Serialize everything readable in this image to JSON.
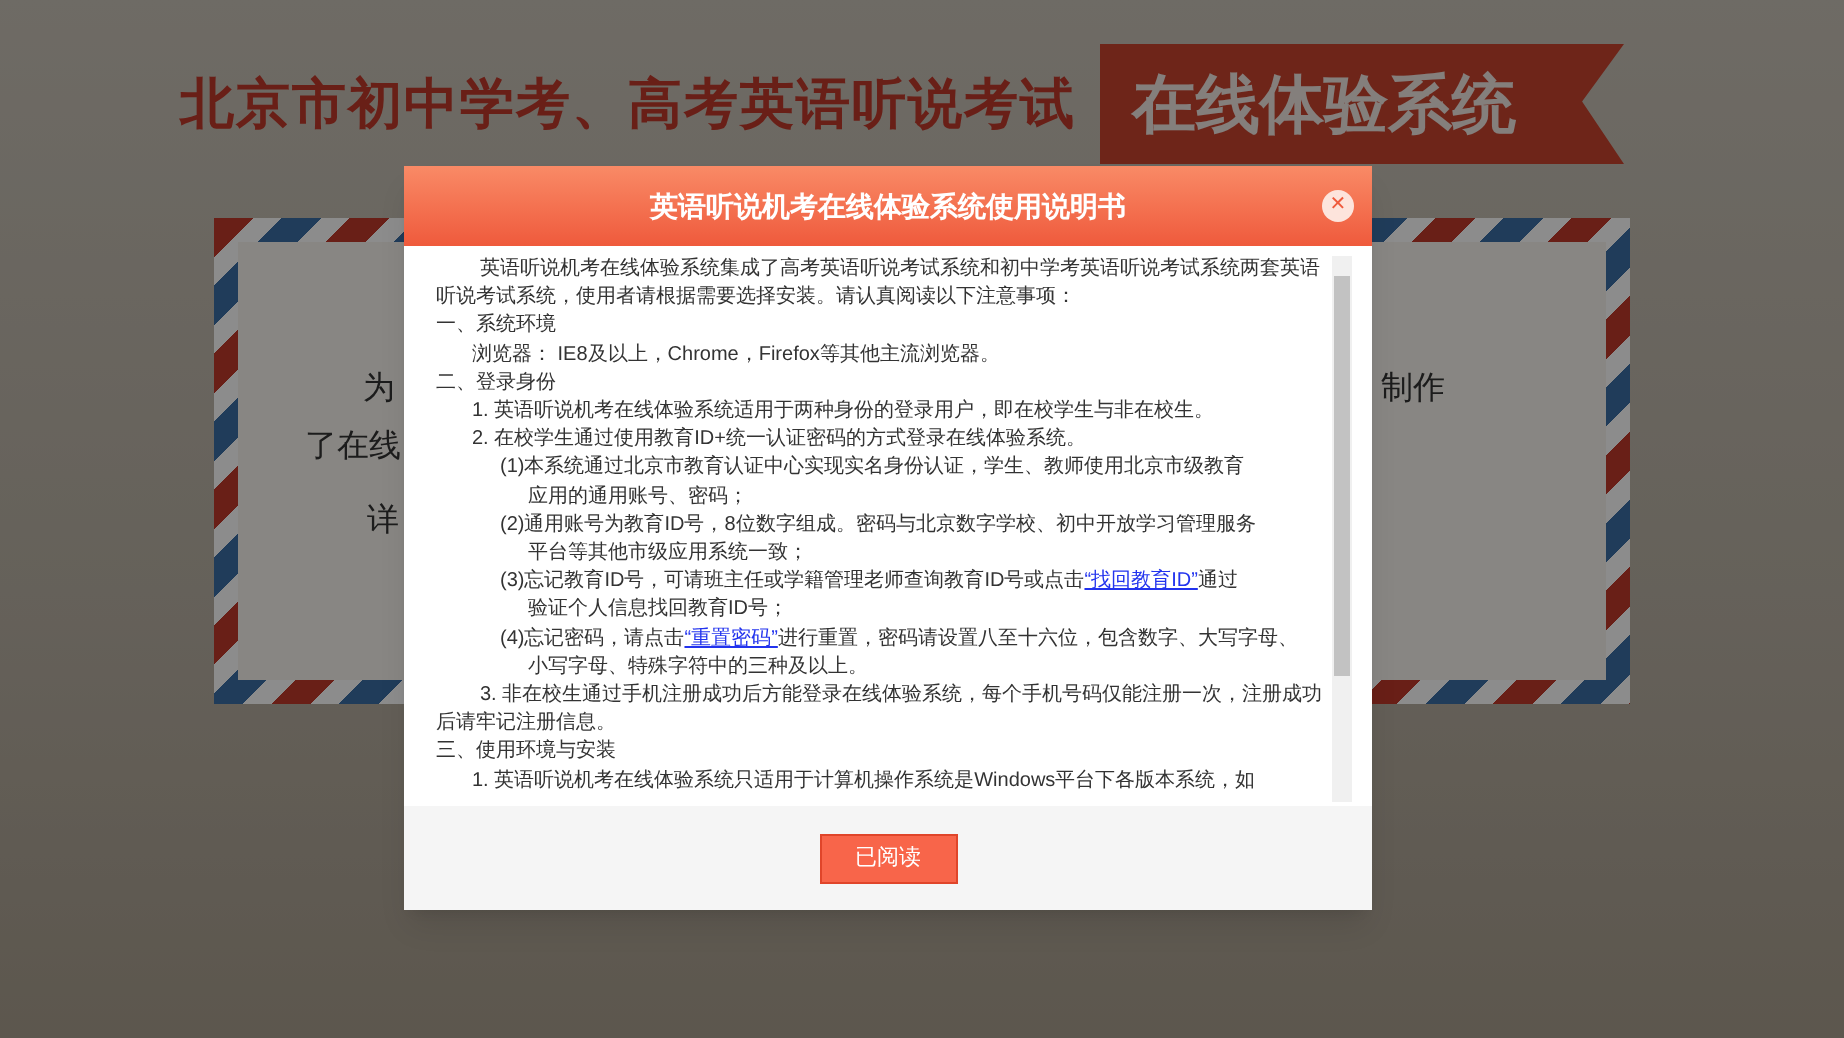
{
  "banner": {
    "title": "北京市初中学考、高考英语听说考试",
    "ribbon": "在线体验系统"
  },
  "background_card": {
    "lines": [
      {
        "left": "为",
        "right": "制作"
      },
      {
        "left": "了在线"
      },
      {
        "left": "详"
      }
    ]
  },
  "dialog": {
    "title": "英语听说机考在线体验系统使用说明书",
    "close": "✕",
    "content": [
      {
        "kind": "para",
        "segments": [
          {
            "text": "英语听说机考在线体验系统集成了高考英语听说考试系统和初中学考英语听说考试系统两套英语听说考试系统，使用者请根据需要选择安装。请认真阅读以下注意事项："
          }
        ]
      },
      {
        "kind": "heading",
        "segments": [
          {
            "text": "一、系统环境"
          }
        ]
      },
      {
        "kind": "item",
        "segments": [
          {
            "text": "浏览器： IE8及以上，Chrome，Firefox等其他主流浏览器。"
          }
        ]
      },
      {
        "kind": "heading",
        "segments": [
          {
            "text": "二、登录身份"
          }
        ]
      },
      {
        "kind": "item",
        "segments": [
          {
            "text": "1. 英语听说机考在线体验系统适用于两种身份的登录用户，即在校学生与非在校生。"
          }
        ]
      },
      {
        "kind": "item",
        "segments": [
          {
            "text": "2. 在校学生通过使用教育ID+统一认证密码的方式登录在线体验系统。"
          }
        ]
      },
      {
        "kind": "sub",
        "segments": [
          {
            "text": "(1)本系统通过北京市教育认证中心实现实名身份认证，学生、教师使用北京市级教育"
          }
        ]
      },
      {
        "kind": "subcont",
        "segments": [
          {
            "text": "应用的通用账号、密码；"
          }
        ]
      },
      {
        "kind": "sub",
        "segments": [
          {
            "text": "(2)通用账号为教育ID号，8位数字组成。密码与北京数字学校、初中开放学习管理服务"
          }
        ]
      },
      {
        "kind": "subcont",
        "segments": [
          {
            "text": "平台等其他市级应用系统一致；"
          }
        ]
      },
      {
        "kind": "sub",
        "segments": [
          {
            "text": "(3)忘记教育ID号，可请班主任或学籍管理老师查询教育ID号或点击"
          },
          {
            "text": "“找回教育ID”",
            "link": true
          },
          {
            "text": "通过"
          }
        ]
      },
      {
        "kind": "subcont",
        "segments": [
          {
            "text": "验证个人信息找回教育ID号；"
          }
        ]
      },
      {
        "kind": "sub",
        "segments": [
          {
            "text": "(4)忘记密码，请点击"
          },
          {
            "text": "“重置密码”",
            "link": true
          },
          {
            "text": "进行重置，密码请设置八至十六位，包含数字、大写字母、"
          }
        ]
      },
      {
        "kind": "subcont",
        "segments": [
          {
            "text": "小写字母、特殊字符中的三种及以上。"
          }
        ]
      },
      {
        "kind": "para",
        "segments": [
          {
            "text": "3. 非在校生通过手机注册成功后方能登录在线体验系统，每个手机号码仅能注册一次，注册成功后请牢记注册信息。"
          }
        ]
      },
      {
        "kind": "heading",
        "segments": [
          {
            "text": "三、使用环境与安装"
          }
        ]
      },
      {
        "kind": "item",
        "segments": [
          {
            "text": "1. 英语听说机考在线体验系统只适用于计算机操作系统是Windows平台下各版本系统，如"
          }
        ]
      }
    ],
    "button": "已阅读"
  }
}
